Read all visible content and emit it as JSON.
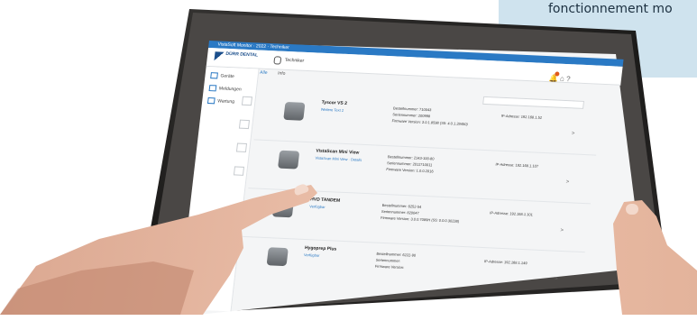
{
  "panel_text": "fonctionnement mo",
  "app": {
    "window_title": "VistaSoft Monitor · 2022 · Techniker",
    "logo": "DÜRR DENTAL",
    "user": "Techniker"
  },
  "sidebar": {
    "items": [
      {
        "label": "Geräte"
      },
      {
        "label": "Meldungen"
      },
      {
        "label": "Wartung"
      }
    ]
  },
  "tabs": {
    "active": "Alle",
    "second": "Info"
  },
  "devices": [
    {
      "name": "Tyscor VS 2",
      "link": "Weitere Text 2",
      "field1": "Bestellnummer: 710043",
      "field2": "Seriennummer: 200998",
      "field3": "Firmware Version: 3.0.1.8598 (S5: 4.0.1.28450)",
      "ip": "IP-Adresse: 192.168.1.52",
      "arrow": ">"
    },
    {
      "name": "VistaScan Mini View",
      "link": "VistaScan Mini View · Details",
      "field1": "Bestellnummer: 2143-100-80",
      "field2": "Seriennummer: 2011710011",
      "field3": "Firmware Version: 1.0.0.2016",
      "ip": "IP-Adresse: 192.168.1.107",
      "arrow": ">"
    },
    {
      "name": "HVD TANDEM",
      "link": "Verfügbar",
      "field1": "Bestellnummer: 6252-54",
      "field2": "Seriennummer: 820047",
      "field3": "Firmware Version: 3.0.0.7089H (S5: 0.0.0.30238)",
      "ip": "IP-Adresse: 192.168.1.101",
      "arrow": ">"
    },
    {
      "name": "Hygoprep Plus",
      "link": "Verfügbar",
      "field1": "Bestellnummer: 6222-90",
      "field2": "Seriennummer:",
      "field3": "Firmware Version:",
      "ip": "IP-Adresse: 192.168.1.149",
      "arrow": ">"
    }
  ],
  "colors": {
    "accent": "#2a79c4",
    "badge": "#e05a1a",
    "panel": "#cfe3ee"
  }
}
